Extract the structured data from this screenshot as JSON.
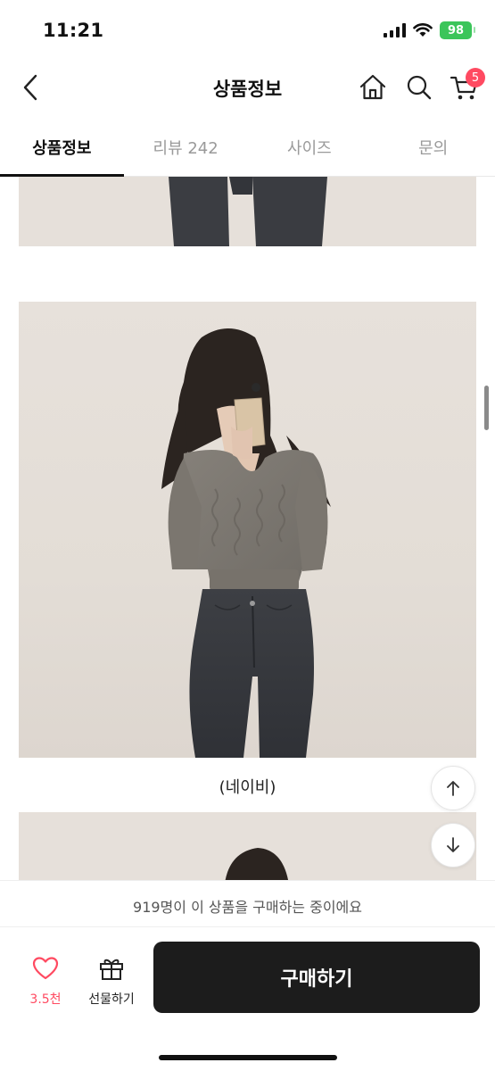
{
  "status_bar": {
    "time": "11:21",
    "battery": "98"
  },
  "nav": {
    "title": "상품정보",
    "cart_count": "5"
  },
  "tabs": [
    {
      "label": "상품정보",
      "active": true
    },
    {
      "label": "리뷰 242",
      "active": false
    },
    {
      "label": "사이즈",
      "active": false
    },
    {
      "label": "문의",
      "active": false
    }
  ],
  "content": {
    "caption": "(네이비)"
  },
  "bottom": {
    "notice": "919명이 이 상품을 구매하는 중이에요",
    "like_count": "3.5천",
    "gift_label": "선물하기",
    "buy_label": "구매하기"
  },
  "colors": {
    "accent": "#ff4a61",
    "buy_button": "#1c1c1c",
    "battery": "#3bc55a"
  }
}
